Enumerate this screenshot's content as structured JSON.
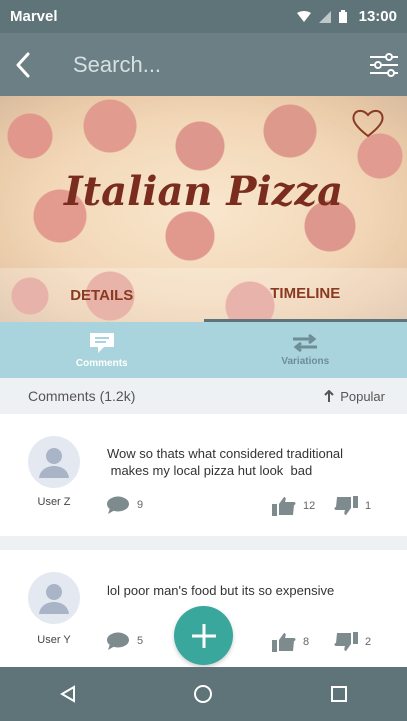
{
  "status_bar": {
    "carrier": "Marvel",
    "time": "13:00"
  },
  "search": {
    "placeholder": "Search..."
  },
  "hero": {
    "title": "Italian Pizza"
  },
  "tabs": [
    {
      "label": "DETAILS",
      "active": false
    },
    {
      "label": "TIMELINE",
      "active": true
    }
  ],
  "subtabs": [
    {
      "label": "Comments",
      "icon": "comment-icon",
      "active": true
    },
    {
      "label": "Variations",
      "icon": "swap-arrows-icon",
      "active": false
    }
  ],
  "comments_header": {
    "title": "Comments (1.2k)",
    "sort_label": "Popular"
  },
  "comments": [
    {
      "user": "User Z",
      "text_line1": "Wow so thats what considered traditional",
      "text_line2": " makes my local pizza hut look  bad",
      "replies": "9",
      "likes": "12",
      "dislikes": "1"
    },
    {
      "user": "User Y",
      "text_line1": "lol poor man's food but its so expensive",
      "text_line2": "",
      "replies": "5",
      "likes": "8",
      "dislikes": "2"
    }
  ],
  "colors": {
    "toolbar": "#6b7f84",
    "subtabs": "#a9d4de",
    "fab": "#3aa79c",
    "accent_text": "#8a3a22"
  }
}
